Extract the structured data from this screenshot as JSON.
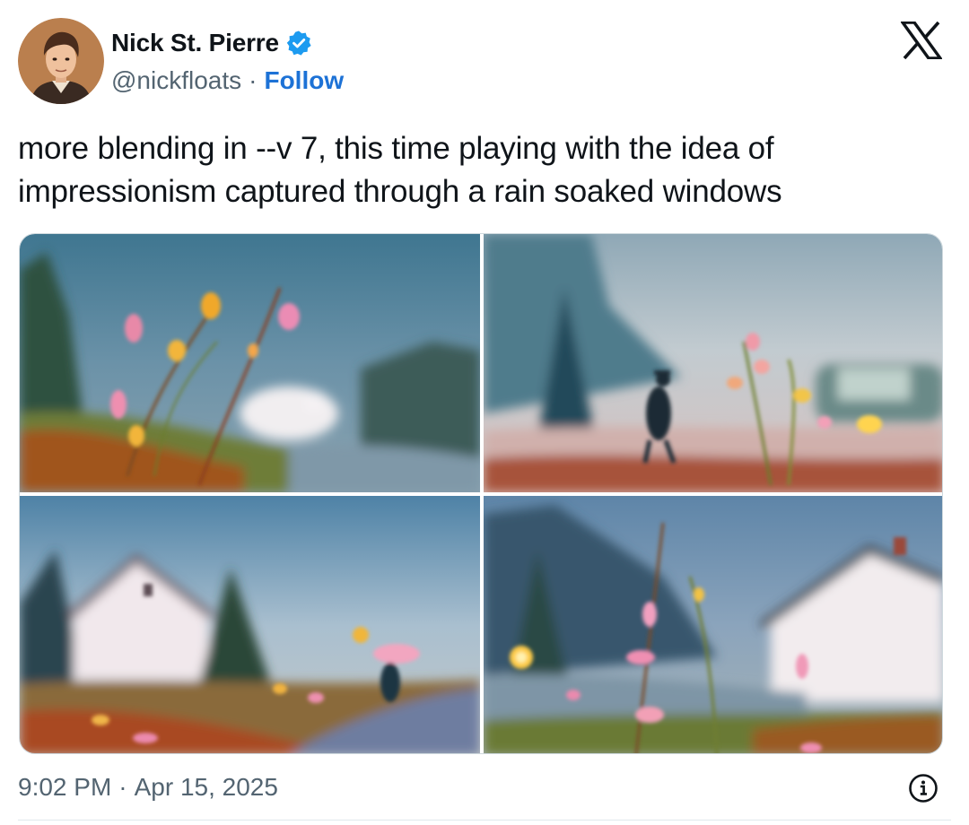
{
  "author": {
    "display_name": "Nick St. Pierre",
    "handle": "@nickfloats",
    "separator": "·",
    "follow_label": "Follow",
    "verified": true
  },
  "tweet": {
    "text": "more blending in --v 7, this time playing with the idea of impressionism captured through a rain soaked windows"
  },
  "media": {
    "images": [
      {
        "name": "image-1"
      },
      {
        "name": "image-2"
      },
      {
        "name": "image-3"
      },
      {
        "name": "image-4"
      }
    ]
  },
  "footer": {
    "time": "9:02 PM",
    "separator": "·",
    "date": "Apr 15, 2025"
  },
  "icons": {
    "verified": "verified-badge-icon",
    "platform": "x-logo-icon",
    "info": "info-icon"
  },
  "colors": {
    "link": "#1d72d6",
    "verified": "#1d9bf0",
    "muted": "#536471",
    "text": "#0f1419"
  }
}
